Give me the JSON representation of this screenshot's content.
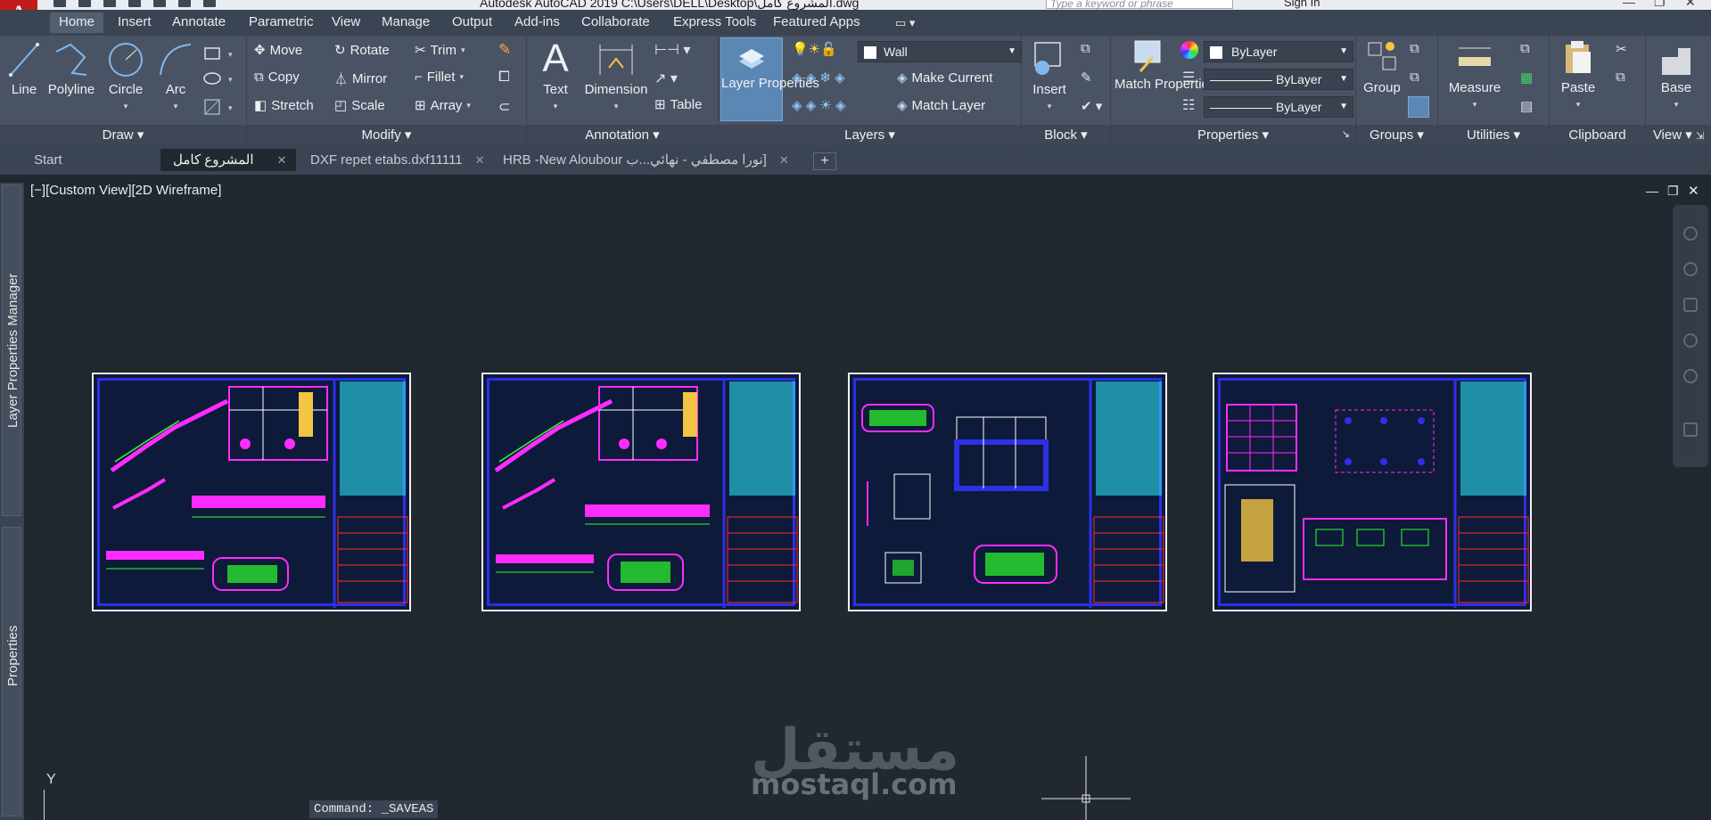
{
  "window": {
    "title": "Autodesk AutoCAD 2019    C:\\Users\\DELL\\Desktop\\المشروع كامل.dwg",
    "search_placeholder": "Type a keyword or phrase",
    "sign_in": "Sign In"
  },
  "ribbon_tabs": [
    "Home",
    "Insert",
    "Annotate",
    "Parametric",
    "View",
    "Manage",
    "Output",
    "Add-ins",
    "Collaborate",
    "Express Tools",
    "Featured Apps"
  ],
  "panels": {
    "draw": {
      "title": "Draw",
      "line": "Line",
      "polyline": "Polyline",
      "circle": "Circle",
      "arc": "Arc"
    },
    "modify": {
      "title": "Modify",
      "move": "Move",
      "rotate": "Rotate",
      "trim": "Trim",
      "copy": "Copy",
      "mirror": "Mirror",
      "fillet": "Fillet",
      "stretch": "Stretch",
      "scale": "Scale",
      "array": "Array"
    },
    "annotation": {
      "title": "Annotation",
      "text": "Text",
      "dimension": "Dimension",
      "table": "Table"
    },
    "layers": {
      "title": "Layers",
      "layer_properties": "Layer Properties",
      "current_layer": "Wall",
      "make_current": "Make Current",
      "match_layer": "Match Layer"
    },
    "block": {
      "title": "Block",
      "insert": "Insert"
    },
    "properties": {
      "title": "Properties",
      "match_properties": "Match Properties",
      "color": "ByLayer",
      "linetype": "ByLayer",
      "lineweight": "ByLayer"
    },
    "groups": {
      "title": "Groups",
      "group": "Group"
    },
    "utilities": {
      "title": "Utilities",
      "measure": "Measure"
    },
    "clipboard": {
      "title": "Clipboard",
      "paste": "Paste"
    },
    "view": {
      "title": "View",
      "base": "Base"
    }
  },
  "doc_tabs": [
    {
      "label": "Start"
    },
    {
      "label": "المشروع كامل"
    },
    {
      "label": "DXF repet etabs.dxf11111"
    },
    {
      "label": "HRB -New Aloubour نورا مصطفي - نهائي...ب]"
    }
  ],
  "palettes": {
    "layer_manager": "Layer Properties Manager",
    "properties": "Properties"
  },
  "viewport": {
    "label": "[−][Custom View][2D Wireframe]",
    "ucs_y": "Y"
  },
  "command_line": "Command: _SAVEAS",
  "watermark": {
    "logo": "مستقل",
    "domain": "mostaql.com"
  },
  "colors": {
    "accent_red": "#c21b1b",
    "ribbon_bg": "#4a5363",
    "canvas_bg": "#212830",
    "sheet_blue": "#2d30e6",
    "magenta": "#ff2cff",
    "green": "#2cff2c",
    "cyan": "#2cf0ff"
  }
}
